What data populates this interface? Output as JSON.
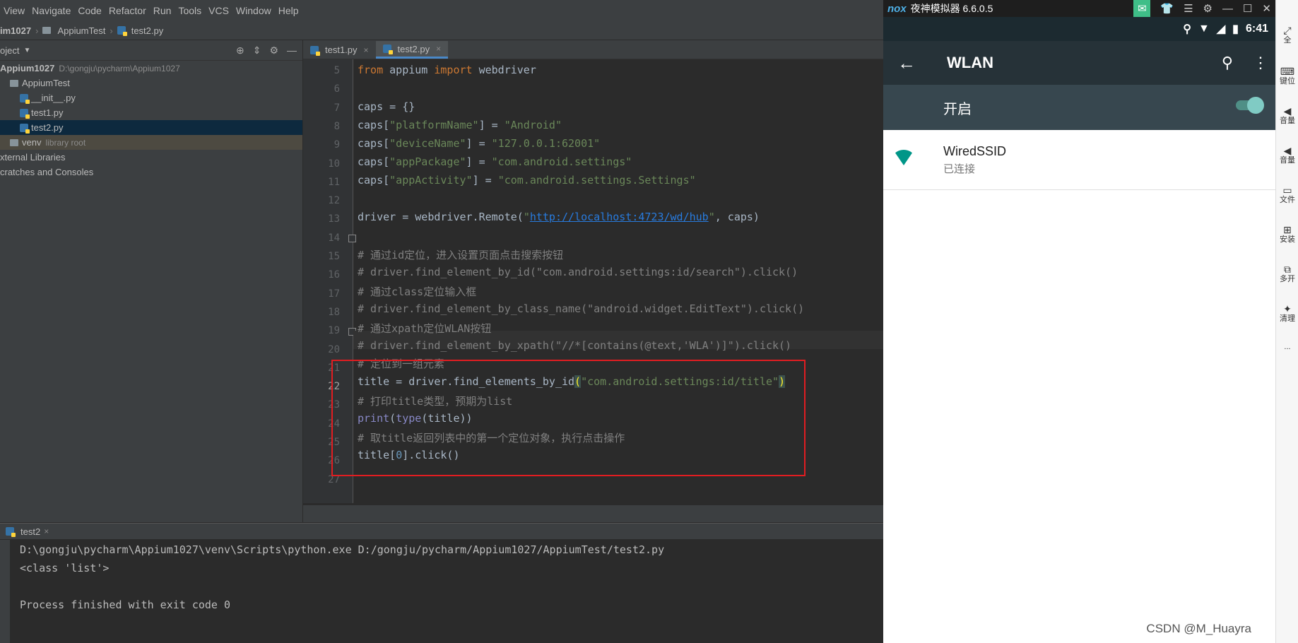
{
  "menu": [
    "View",
    "Navigate",
    "Code",
    "Refactor",
    "Run",
    "Tools",
    "VCS",
    "Window",
    "Help"
  ],
  "breadcrumb": [
    "im1027",
    "AppiumTest",
    "test2.py"
  ],
  "project": {
    "header": "oject",
    "tree": [
      {
        "label": "Appium1027",
        "extra": "D:\\gongju\\pycharm\\Appium1027",
        "indent": 0,
        "kind": "folder"
      },
      {
        "label": "AppiumTest",
        "extra": "",
        "indent": 1,
        "kind": "folder"
      },
      {
        "label": "__init__.py",
        "extra": "",
        "indent": 2,
        "kind": "py"
      },
      {
        "label": "test1.py",
        "extra": "",
        "indent": 2,
        "kind": "py"
      },
      {
        "label": "test2.py",
        "extra": "",
        "indent": 2,
        "kind": "py",
        "selected": true
      },
      {
        "label": "venv",
        "extra": "library root",
        "indent": 1,
        "kind": "folder",
        "venv": true
      },
      {
        "label": "xternal Libraries",
        "extra": "",
        "indent": 0,
        "kind": "lib"
      },
      {
        "label": "cratches and Consoles",
        "extra": "",
        "indent": 0,
        "kind": "lib"
      }
    ]
  },
  "editor": {
    "tabs": [
      {
        "label": "test1.py",
        "active": false
      },
      {
        "label": "test2.py",
        "active": true
      }
    ],
    "line_numbers": [
      "5",
      "6",
      "7",
      "8",
      "9",
      "10",
      "11",
      "12",
      "13",
      "14",
      "15",
      "16",
      "17",
      "18",
      "19",
      "20",
      "21",
      "22",
      "23",
      "24",
      "25",
      "26",
      "27"
    ],
    "current_line": "22"
  },
  "code": {
    "l5a": "from",
    "l5b": " appium ",
    "l5c": "import",
    "l5d": " webdriver",
    "l7": "caps = {}",
    "l8a": "caps[",
    "l8b": "\"platformName\"",
    "l8c": "] = ",
    "l8d": "\"Android\"",
    "l9a": "caps[",
    "l9b": "\"deviceName\"",
    "l9c": "] = ",
    "l9d": "\"127.0.0.1:62001\"",
    "l10a": "caps[",
    "l10b": "\"appPackage\"",
    "l10c": "] = ",
    "l10d": "\"com.android.settings\"",
    "l11a": "caps[",
    "l11b": "\"appActivity\"",
    "l11c": "] = ",
    "l11d": "\"com.android.settings.Settings\"",
    "l13a": "driver = webdriver.Remote(",
    "l13b": "\"",
    "l13c": "http://localhost:4723/wd/hub",
    "l13d": "\"",
    "l13e": ", caps)",
    "l15": "# 通过id定位，进入设置页面点击搜索按钮",
    "l16": "# driver.find_element_by_id(\"com.android.settings:id/search\").click()",
    "l17": "# 通过class定位输入框",
    "l18": "# driver.find_element_by_class_name(\"android.widget.EditText\").click()",
    "l19": "# 通过xpath定位WLAN按钮",
    "l20": "# driver.find_element_by_xpath(\"//*[contains(@text,'WLA')]\").click()",
    "l21": "# 定位到一组元素",
    "l22a": "title = driver.find_elements_by_id",
    "l22b": "(",
    "l22c": "\"com.android.settings:id/title\"",
    "l22d": ")",
    "l23": "# 打印title类型，预期为list",
    "l24a": "print",
    "l24b": "(",
    "l24c": "type",
    "l24d": "(title))",
    "l25": "# 取title返回列表中的第一个定位对象，执行点击操作",
    "l26a": "title[",
    "l26b": "0",
    "l26c": "].click()"
  },
  "run": {
    "tab": "test2",
    "lines": [
      "D:\\gongju\\pycharm\\Appium1027\\venv\\Scripts\\python.exe D:/gongju/pycharm/Appium1027/AppiumTest/test2.py",
      "<class 'list'>",
      "",
      "Process finished with exit code 0"
    ]
  },
  "emulator": {
    "brand": "nox",
    "title": "夜神模拟器 6.6.0.5",
    "time": "6:41",
    "appbar_title": "WLAN",
    "switch_label": "开启",
    "wifi": {
      "name": "WiredSSID",
      "status": "已连接"
    },
    "side": [
      "全",
      "键位",
      "音量",
      "音量",
      "文件",
      "安装",
      "多开",
      "清理",
      "..."
    ],
    "accent": "#009688"
  },
  "watermark": "CSDN @M_Huayra"
}
